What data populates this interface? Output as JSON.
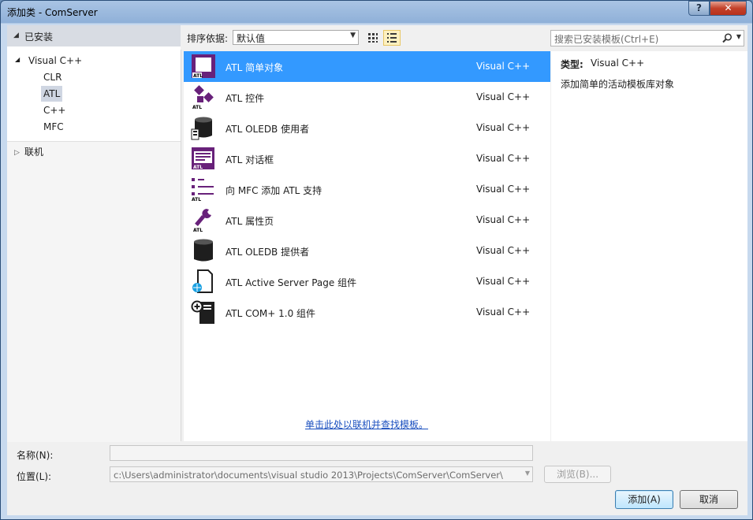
{
  "window": {
    "title": "添加类 - ComServer",
    "help_label": "?",
    "close_label": "✕"
  },
  "tree": {
    "header_label": "已安装",
    "root_label": "Visual C++",
    "children": [
      {
        "label": "CLR"
      },
      {
        "label": "ATL"
      },
      {
        "label": "C++"
      },
      {
        "label": "MFC"
      }
    ],
    "selected": "ATL",
    "online_label": "联机"
  },
  "toolbar": {
    "sort_label": "排序依据:",
    "sort_value": "默认值",
    "search_placeholder": "搜索已安装模板(Ctrl+E)"
  },
  "templates": [
    {
      "name": "ATL 简单对象",
      "lang": "Visual C++",
      "icon": "atl-simple-object-icon",
      "selected": true
    },
    {
      "name": "ATL 控件",
      "lang": "Visual C++",
      "icon": "atl-control-icon"
    },
    {
      "name": "ATL OLEDB 使用者",
      "lang": "Visual C++",
      "icon": "database-consumer-icon"
    },
    {
      "name": "ATL 对话框",
      "lang": "Visual C++",
      "icon": "atl-dialog-icon"
    },
    {
      "name": "向 MFC 添加 ATL 支持",
      "lang": "Visual C++",
      "icon": "atl-mfc-support-icon"
    },
    {
      "name": "ATL 属性页",
      "lang": "Visual C++",
      "icon": "atl-property-page-icon"
    },
    {
      "name": "ATL OLEDB 提供者",
      "lang": "Visual C++",
      "icon": "database-provider-icon"
    },
    {
      "name": "ATL Active Server Page 组件",
      "lang": "Visual C++",
      "icon": "asp-component-icon"
    },
    {
      "name": "ATL COM+ 1.0 组件",
      "lang": "Visual C++",
      "icon": "com-plus-component-icon"
    }
  ],
  "online_link": "单击此处以联机并查找模板。",
  "details": {
    "type_label": "类型:",
    "type_value": "Visual C++",
    "description": "添加简单的活动模板库对象"
  },
  "form": {
    "name_label": "名称(N):",
    "name_value": "",
    "location_label": "位置(L):",
    "location_value": "c:\\Users\\administrator\\documents\\visual studio 2013\\Projects\\ComServer\\ComServer\\",
    "browse_label": "浏览(B)...",
    "add_label": "添加(A)",
    "cancel_label": "取消"
  },
  "colors": {
    "accent": "#3399ff",
    "atl_purple": "#68217a",
    "link": "#1a4fbf"
  }
}
